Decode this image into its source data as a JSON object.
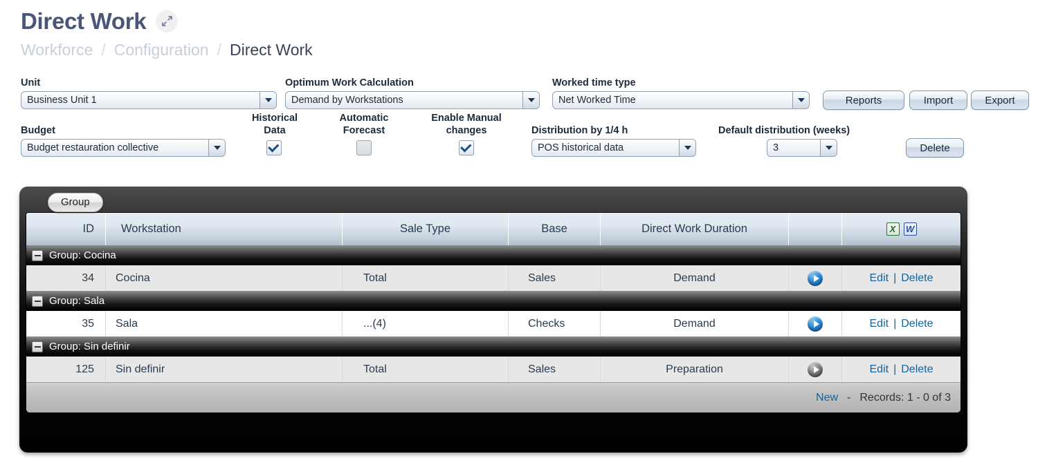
{
  "header": {
    "title": "Direct Work",
    "expand_icon": "expand-arrows-icon",
    "breadcrumb": [
      "Workforce",
      "Configuration",
      "Direct Work"
    ],
    "separator": "/"
  },
  "filters": {
    "unit": {
      "label": "Unit",
      "value": "Business Unit 1"
    },
    "optimum": {
      "label": "Optimum Work Calculation",
      "value": "Demand by Workstations"
    },
    "worked_time": {
      "label": "Worked time type",
      "value": "Net Worked Time"
    },
    "budget": {
      "label": "Budget",
      "value": "Budget restauration collective"
    },
    "historical": {
      "label_l1": "Historical",
      "label_l2": "Data",
      "checked": true
    },
    "forecast": {
      "label_l1": "Automatic",
      "label_l2": "Forecast",
      "checked": false
    },
    "manual": {
      "label_l1": "Enable Manual",
      "label_l2": "changes",
      "checked": true
    },
    "distribution": {
      "label": "Distribution by 1/4 h",
      "value": "POS historical data"
    },
    "default_distribution": {
      "label": "Default distribution (weeks)",
      "value": "3"
    }
  },
  "buttons": {
    "reports": "Reports",
    "import": "Import",
    "export": "Export",
    "delete": "Delete"
  },
  "grid": {
    "tab": "Group",
    "columns": [
      "ID",
      "Workstation",
      "Sale Type",
      "Base",
      "Direct Work Duration"
    ],
    "export_icons": {
      "excel": "X",
      "word": "W"
    },
    "groups": [
      {
        "label": "Group: Cocina",
        "rows": [
          {
            "id": "34",
            "workstation": "Cocina",
            "sale_type": "Total",
            "base": "Sales",
            "duration": "Demand",
            "arrow": "blue",
            "edit": "Edit",
            "sep": "|",
            "delete": "Delete",
            "shade": "alt"
          }
        ]
      },
      {
        "label": "Group: Sala",
        "rows": [
          {
            "id": "35",
            "workstation": "Sala",
            "sale_type": "...(4)",
            "base": "Checks",
            "duration": "Demand",
            "arrow": "blue",
            "edit": "Edit",
            "sep": "|",
            "delete": "Delete",
            "shade": "plain"
          }
        ]
      },
      {
        "label": "Group: Sin definir",
        "rows": [
          {
            "id": "125",
            "workstation": "Sin definir",
            "sale_type": "Total",
            "base": "Sales",
            "duration": "Preparation",
            "arrow": "gray",
            "edit": "Edit",
            "sep": "|",
            "delete": "Delete",
            "shade": "alt"
          }
        ]
      }
    ],
    "footer": {
      "new": "New",
      "dash": "-",
      "records": "Records: 1 - 0 of 3"
    }
  },
  "colors": {
    "title": "#4a5578",
    "breadcrumb_muted": "#c9cddd",
    "link": "#15639c",
    "excel_green": "#1e6b2e",
    "word_blue": "#2b4f9e"
  }
}
